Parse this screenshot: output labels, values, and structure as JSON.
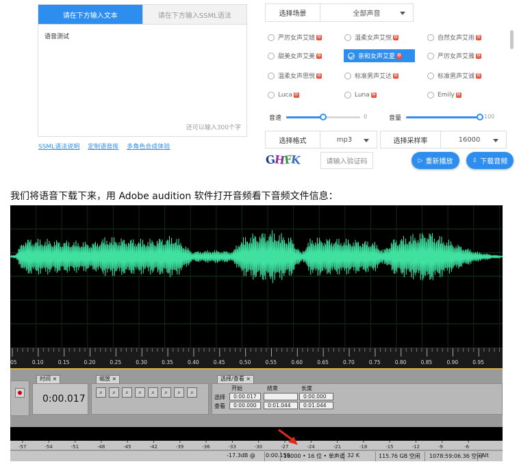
{
  "tabs": {
    "text_tab": "请在下方输入文本",
    "ssml_tab": "请在下方输入SSML语法"
  },
  "textarea": {
    "value": "语音测试",
    "counter": "还可以输入300个字"
  },
  "links": [
    "SSML语法说明",
    "定制语音库",
    "多角色合成体验"
  ],
  "scene": {
    "label": "选择场景",
    "value": "全部声音"
  },
  "voices": [
    "严厉女声艾婧",
    "温柔女声艾悦",
    "自然女声艾雨",
    "甜美女声艾美",
    "亲和女声艾夏",
    "严厉女声艾雅",
    "温柔女声思悦",
    "标准男声艾达",
    "标准男声艾诚",
    "Luca",
    "Luna",
    "Emily"
  ],
  "selected_voice": "亲和女声艾夏",
  "badge_glyph": "荐",
  "speed": {
    "label": "音速",
    "value": "0",
    "level": 0.5
  },
  "volume": {
    "label": "音量",
    "value": "100",
    "level": 1.0
  },
  "format": {
    "label": "选择格式",
    "value": "mp3"
  },
  "samplerate": {
    "label": "选择采样率",
    "value": "16000"
  },
  "captcha": {
    "image_text": "GHFK",
    "placeholder": "请输入验证码"
  },
  "buttons": {
    "replay": "重新播放",
    "download": "下载音频"
  },
  "caption": "我们将语音下载下来，用 Adobe audition 软件打开音频看下音频文件信息：",
  "audition": {
    "time_ticks": [
      "05",
      "0.10",
      "0.15",
      "0.20",
      "0.25",
      "0.30",
      "0.35",
      "0.40",
      "0.45",
      "0.50",
      "0.55",
      "0.60",
      "0.65",
      "0.70",
      "0.75",
      "0.80",
      "0.85",
      "0.90",
      "0.95"
    ],
    "time_panel_tab": "时间",
    "time_display": "0:00.017",
    "zoom_panel_tab": "缩放",
    "selection_panel_tab": "选择/查看",
    "col_start": "开始",
    "col_end": "结束",
    "col_length": "长度",
    "row_select": "选择",
    "row_view": "查看",
    "select_start": "0:00.017",
    "select_end": "",
    "select_length": "0:00.000",
    "view_start": "0:00.000",
    "view_end": "0:01.044",
    "view_length": "0:01.044",
    "db_ticks": [
      "-57",
      "-54",
      "-51",
      "-48",
      "-45",
      "-42",
      "-39",
      "-36",
      "-33",
      "-30",
      "-27",
      "-24",
      "-21",
      "-18",
      "-15",
      "-12",
      "-9",
      "-6"
    ],
    "status": [
      "-17.3dB @",
      "0:00.159",
      "16000 • 16 位 • 单声道",
      "32 K",
      "115.76 GB 空闲",
      "1078:59:06.36 空闲",
      "Alt"
    ],
    "wave_color": "#3fe0a0"
  },
  "colors": {
    "accent": "#2e8ef0",
    "badge": "#e8503a",
    "arrow": "#e02a1a"
  }
}
